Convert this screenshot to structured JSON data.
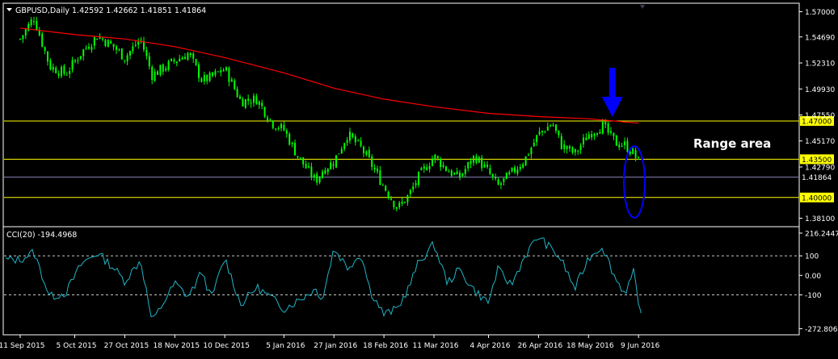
{
  "header": {
    "symbol": "GBPUSD,Daily",
    "ohlc": "1.42592 1.42662 1.41851 1.41864"
  },
  "annotation": {
    "range_label": "Range area"
  },
  "colors": {
    "background": "#000000",
    "border": "#ffffff",
    "candle": "#00ff00",
    "moving_average": "#ff0000",
    "level_lines": "#ffff00",
    "current_price_line": "#7f7fb0",
    "cci_line": "#1fb5c5",
    "arrow": "#0000ff",
    "ellipse": "#0000ff"
  },
  "chart_data": [
    {
      "type": "candlestick",
      "ylim": [
        1.374,
        1.577
      ],
      "y_ticks": [
        "1.57000",
        "1.54690",
        "1.52310",
        "1.49930",
        "1.47550",
        "1.45170",
        "1.42790",
        "1.38100"
      ],
      "x_ticks": [
        "11 Sep 2015",
        "5 Oct 2015",
        "27 Oct 2015",
        "18 Nov 2015",
        "10 Dec 2015",
        "5 Jan 2016",
        "27 Jan 2016",
        "18 Feb 2016",
        "11 Mar 2016",
        "4 Apr 2016",
        "26 Apr 2016",
        "18 May 2016",
        "9 Jun 2016"
      ],
      "close_path": [
        [
          "11 Sep 2015",
          1.545
        ],
        [
          "17 Sep 2015",
          1.565
        ],
        [
          "24 Sep 2015",
          1.52
        ],
        [
          "1 Oct 2015",
          1.513
        ],
        [
          "8 Oct 2015",
          1.533
        ],
        [
          "15 Oct 2015",
          1.548
        ],
        [
          "22 Oct 2015",
          1.538
        ],
        [
          "27 Oct 2015",
          1.528
        ],
        [
          "3 Nov 2015",
          1.545
        ],
        [
          "8 Nov 2015",
          1.512
        ],
        [
          "18 Nov 2015",
          1.525
        ],
        [
          "24 Nov 2015",
          1.532
        ],
        [
          "30 Nov 2015",
          1.507
        ],
        [
          "4 Dec 2015",
          1.51
        ],
        [
          "10 Dec 2015",
          1.518
        ],
        [
          "17 Dec 2015",
          1.488
        ],
        [
          "24 Dec 2015",
          1.49
        ],
        [
          "31 Dec 2015",
          1.468
        ],
        [
          "5 Jan 2016",
          1.462
        ],
        [
          "11 Jan 2016",
          1.438
        ],
        [
          "19 Jan 2016",
          1.415
        ],
        [
          "22 Jan 2016",
          1.425
        ],
        [
          "27 Jan 2016",
          1.433
        ],
        [
          "2 Feb 2016",
          1.458
        ],
        [
          "8 Feb 2016",
          1.445
        ],
        [
          "12 Feb 2016",
          1.432
        ],
        [
          "18 Feb 2016",
          1.41
        ],
        [
          "24 Feb 2016",
          1.39
        ],
        [
          "29 Feb 2016",
          1.402
        ],
        [
          "4 Mar 2016",
          1.418
        ],
        [
          "11 Mar 2016",
          1.438
        ],
        [
          "17 Mar 2016",
          1.425
        ],
        [
          "22 Mar 2016",
          1.418
        ],
        [
          "29 Mar 2016",
          1.438
        ],
        [
          "4 Apr 2016",
          1.423
        ],
        [
          "8 Apr 2016",
          1.41
        ],
        [
          "14 Apr 2016",
          1.422
        ],
        [
          "20 Apr 2016",
          1.435
        ],
        [
          "26 Apr 2016",
          1.458
        ],
        [
          "2 May 2016",
          1.468
        ],
        [
          "6 May 2016",
          1.448
        ],
        [
          "12 May 2016",
          1.44
        ],
        [
          "18 May 2016",
          1.458
        ],
        [
          "24 May 2016",
          1.466
        ],
        [
          "30 May 2016",
          1.45
        ],
        [
          "3 Jun 2016",
          1.448
        ],
        [
          "7 Jun 2016",
          1.44
        ],
        [
          "9 Jun 2016",
          1.432
        ],
        [
          "10 Jun 2016",
          1.419
        ]
      ],
      "moving_average_path": [
        [
          "11 Sep 2015",
          1.555
        ],
        [
          "5 Oct 2015",
          1.549
        ],
        [
          "27 Oct 2015",
          1.545
        ],
        [
          "18 Nov 2015",
          1.538
        ],
        [
          "10 Dec 2015",
          1.528
        ],
        [
          "5 Jan 2016",
          1.514
        ],
        [
          "27 Jan 2016",
          1.5
        ],
        [
          "18 Feb 2016",
          1.49
        ],
        [
          "11 Mar 2016",
          1.483
        ],
        [
          "4 Apr 2016",
          1.477
        ],
        [
          "26 Apr 2016",
          1.474
        ],
        [
          "18 May 2016",
          1.472
        ],
        [
          "9 Jun 2016",
          1.468
        ]
      ],
      "levels": [
        {
          "label": "1.47000",
          "value": 1.47
        },
        {
          "label": "1.43500",
          "value": 1.435
        },
        {
          "label": "1.40000",
          "value": 1.4
        }
      ],
      "current_price": {
        "label": "1.41864",
        "value": 1.41864
      },
      "ellipse_low": 1.3815,
      "ellipse_high": 1.447,
      "arrow_peak_date": "26 May 2016"
    },
    {
      "type": "line",
      "indicator_label": "CCI(20) -194.4968",
      "ylim": [
        -300,
        245
      ],
      "y_ticks": [
        "216.2447",
        "100",
        "0.00",
        "-100",
        "-272.8061"
      ],
      "reference_lines": [
        100,
        -100
      ],
      "path": [
        [
          "11 Sep 2015",
          80
        ],
        [
          "17 Sep 2015",
          120
        ],
        [
          "24 Sep 2015",
          -110
        ],
        [
          "1 Oct 2015",
          -90
        ],
        [
          "8 Oct 2015",
          60
        ],
        [
          "15 Oct 2015",
          115
        ],
        [
          "22 Oct 2015",
          40
        ],
        [
          "27 Oct 2015",
          -30
        ],
        [
          "3 Nov 2015",
          80
        ],
        [
          "8 Nov 2015",
          -240
        ],
        [
          "18 Nov 2015",
          -40
        ],
        [
          "24 Nov 2015",
          -110
        ],
        [
          "30 Nov 2015",
          20
        ],
        [
          "4 Dec 2015",
          -120
        ],
        [
          "10 Dec 2015",
          90
        ],
        [
          "17 Dec 2015",
          -150
        ],
        [
          "24 Dec 2015",
          -60
        ],
        [
          "31 Dec 2015",
          -120
        ],
        [
          "5 Jan 2016",
          -170
        ],
        [
          "11 Jan 2016",
          -130
        ],
        [
          "19 Jan 2016",
          -70
        ],
        [
          "22 Jan 2016",
          -120
        ],
        [
          "27 Jan 2016",
          140
        ],
        [
          "2 Feb 2016",
          40
        ],
        [
          "8 Feb 2016",
          110
        ],
        [
          "12 Feb 2016",
          -80
        ],
        [
          "18 Feb 2016",
          -200
        ],
        [
          "24 Feb 2016",
          -170
        ],
        [
          "29 Feb 2016",
          -60
        ],
        [
          "4 Mar 2016",
          60
        ],
        [
          "11 Mar 2016",
          160
        ],
        [
          "17 Mar 2016",
          -40
        ],
        [
          "22 Mar 2016",
          30
        ],
        [
          "29 Mar 2016",
          -80
        ],
        [
          "4 Apr 2016",
          -140
        ],
        [
          "8 Apr 2016",
          30
        ],
        [
          "14 Apr 2016",
          -50
        ],
        [
          "20 Apr 2016",
          100
        ],
        [
          "26 Apr 2016",
          200
        ],
        [
          "2 May 2016",
          130
        ],
        [
          "6 May 2016",
          80
        ],
        [
          "12 May 2016",
          -70
        ],
        [
          "18 May 2016",
          90
        ],
        [
          "24 May 2016",
          150
        ],
        [
          "30 May 2016",
          -20
        ],
        [
          "3 Jun 2016",
          -90
        ],
        [
          "7 Jun 2016",
          20
        ],
        [
          "9 Jun 2016",
          -170
        ],
        [
          "10 Jun 2016",
          -194
        ]
      ]
    }
  ]
}
